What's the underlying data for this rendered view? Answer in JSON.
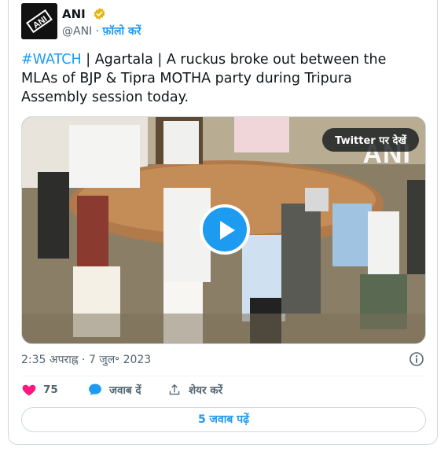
{
  "author": {
    "display_name": "ANI",
    "handle": "@ANI",
    "separator": "·",
    "follow_label": "फ़ॉलो करें",
    "avatar_text": "ANI"
  },
  "tweet": {
    "hashtag": "#WATCH",
    "text": " | Agartala | A ruckus broke out between the MLAs of BJP & Tipra MOTHA party during Tripura Assembly session today.",
    "timestamp": "2:35 अपराह्न · 7 जुल॰ 2023"
  },
  "media": {
    "view_on_twitter_label": "Twitter पर देखें",
    "watermark": "ANI"
  },
  "actions": {
    "like_count": "75",
    "reply_label": "जवाब दें",
    "share_label": "शेयर करें"
  },
  "read_replies_label": "5 जवाब पढ़ें",
  "colors": {
    "accent": "#1d9bf0",
    "like": "#f91880",
    "verified_badge": "#e2b719",
    "text_secondary": "#536471"
  }
}
